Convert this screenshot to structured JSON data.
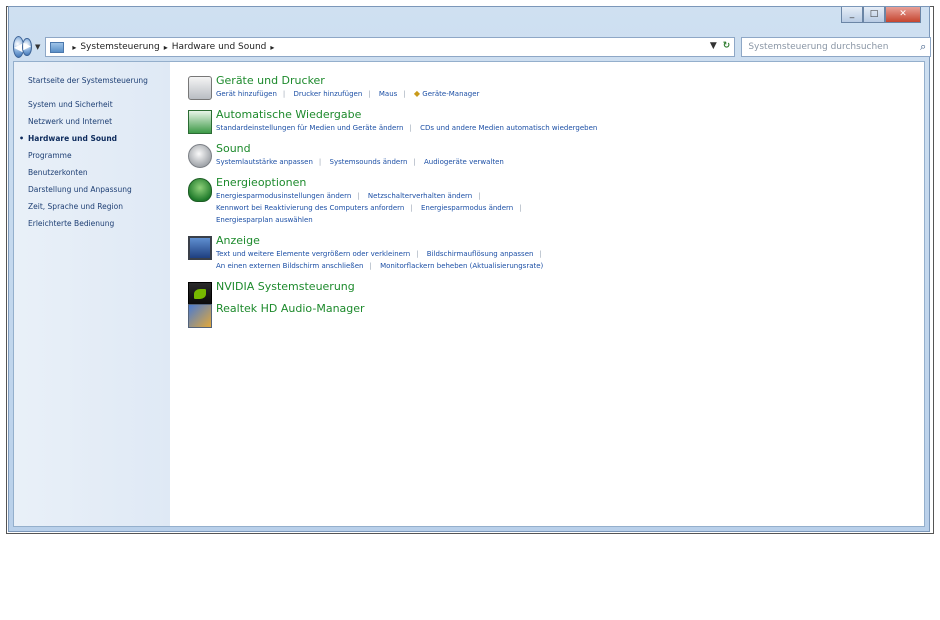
{
  "window": {
    "caption_buttons": [
      "_",
      "□",
      "✕"
    ],
    "breadcrumb": [
      "Systemsteuerung",
      "Hardware und Sound"
    ],
    "search_placeholder": "Systemsteuerung durchsuchen",
    "icons": {
      "back": "back-arrow-icon",
      "forward": "forward-arrow-icon",
      "refresh": "refresh-icon",
      "search": "search-icon"
    }
  },
  "sidebar": {
    "items": [
      {
        "label": "Startseite der Systemsteuerung",
        "active": false
      },
      {
        "label": "System und Sicherheit",
        "active": false
      },
      {
        "label": "Netzwerk und Internet",
        "active": false
      },
      {
        "label": "Hardware und Sound",
        "active": true
      },
      {
        "label": "Programme",
        "active": false
      },
      {
        "label": "Benutzerkonten",
        "active": false
      },
      {
        "label": "Darstellung und Anpassung",
        "active": false
      },
      {
        "label": "Zeit, Sprache und Region",
        "active": false
      },
      {
        "label": "Erleichterte Bedienung",
        "active": false
      }
    ]
  },
  "categories": [
    {
      "title": "Geräte und Drucker",
      "icon": "printer-icon",
      "link_rows": [
        [
          "Gerät hinzufügen",
          "Drucker hinzufügen",
          "Maus",
          "Geräte-Manager"
        ]
      ]
    },
    {
      "title": "Automatische Wiedergabe",
      "icon": "autoplay-icon",
      "link_rows": [
        [
          "Standardeinstellungen für Medien und Geräte ändern",
          "CDs und andere Medien automatisch wiedergeben"
        ]
      ]
    },
    {
      "title": "Sound",
      "icon": "speaker-icon",
      "link_rows": [
        [
          "Systemlautstärke anpassen",
          "Systemsounds ändern",
          "Audiogeräte verwalten"
        ]
      ]
    },
    {
      "title": "Energieoptionen",
      "icon": "battery-icon",
      "link_rows": [
        [
          "Energiesparmodusinstellungen ändern",
          "Netzschalterverhalten ändern"
        ],
        [
          "Kennwort bei Reaktivierung des Computers anfordern",
          "Energiesparmodus ändern"
        ],
        [
          "Energiesparplan auswählen"
        ]
      ]
    },
    {
      "title": "Anzeige",
      "icon": "monitor-icon",
      "link_rows": [
        [
          "Text und weitere Elemente vergrößern oder verkleinern",
          "Bildschirmauflösung anpassen"
        ],
        [
          "An einen externen Bildschirm anschließen",
          "Monitorflackern beheben (Aktualisierungsrate)"
        ]
      ]
    },
    {
      "title": "NVIDIA Systemsteuerung",
      "icon": "nvidia-icon",
      "link_rows": []
    },
    {
      "title": "Realtek HD Audio-Manager",
      "icon": "realtek-icon",
      "link_rows": []
    }
  ]
}
